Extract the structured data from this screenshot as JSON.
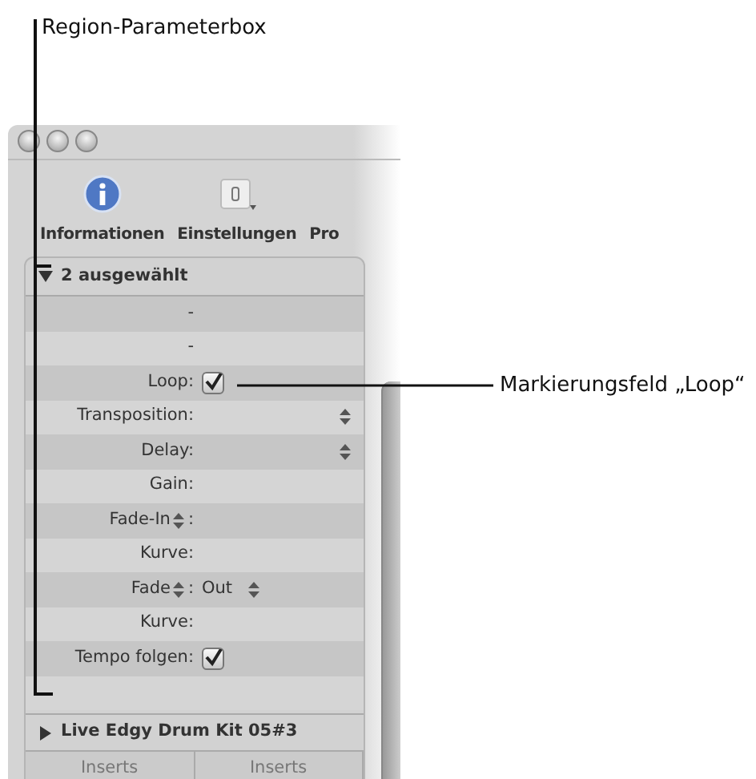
{
  "callouts": [
    {
      "text": "Region-Parameterbox",
      "kind": "bracket"
    },
    {
      "text": "Markierungsfeld „Loop“",
      "kind": "line"
    }
  ],
  "toolbar": [
    {
      "label": "Informationen",
      "kind": "info"
    },
    {
      "label": "Einstellungen",
      "kind": "settings"
    },
    {
      "label": "Pro",
      "kind": "none"
    }
  ],
  "inspector": {
    "header": {
      "label": "2 ausgewählt",
      "expanded": true
    },
    "rows": [
      {
        "kind": "text",
        "label": "-"
      },
      {
        "kind": "text",
        "label": "-"
      },
      {
        "kind": "checkbox",
        "label": "Loop:",
        "checked": true
      },
      {
        "kind": "stepper",
        "label": "Transposition:"
      },
      {
        "kind": "stepper",
        "label": "Delay:"
      },
      {
        "kind": "text",
        "label": "Gain:"
      },
      {
        "kind": "popup",
        "label": "Fade-In",
        "suffix": ":"
      },
      {
        "kind": "text",
        "label": "Kurve:"
      },
      {
        "kind": "popup",
        "label": "Fade",
        "suffix": ":",
        "value": "Out"
      },
      {
        "kind": "text",
        "label": "Kurve:"
      },
      {
        "kind": "checkbox",
        "label": "Tempo folgen:",
        "checked": true
      },
      {
        "kind": "empty"
      }
    ]
  },
  "track": {
    "label": "Live Edgy Drum Kit 05#3",
    "expanded": false
  },
  "bottom_tabs": [
    "Inserts",
    "Inserts"
  ]
}
